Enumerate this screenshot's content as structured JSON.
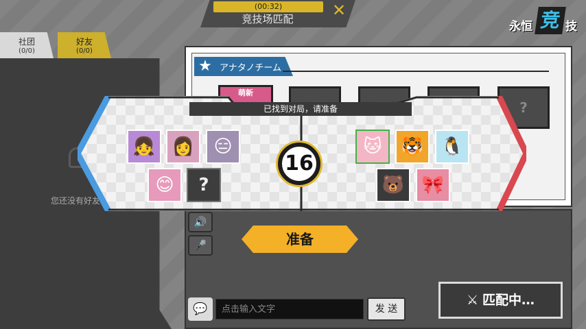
{
  "header": {
    "timer": "(00:32)",
    "title": "竞技场匹配",
    "cancel_icon": "close-icon",
    "accent_color": "#e0b930"
  },
  "logo": {
    "text_left": "永恒",
    "text_mid": "竞",
    "text_right": "技"
  },
  "sidebar": {
    "tabs": [
      {
        "label": "社团",
        "count": "(0/0)"
      },
      {
        "label": "好友",
        "count": "(0/0)"
      }
    ],
    "empty_text": "您还没有好友"
  },
  "team": {
    "title": "アナタノチーム",
    "slots": [
      {
        "label": "萌新"
      },
      {
        "label": "?"
      },
      {
        "label": "?"
      },
      {
        "label": "?"
      },
      {
        "label": "?"
      }
    ]
  },
  "match_found": {
    "message": "已找到对局，请准备",
    "countdown": "16",
    "left_team_color": "#4a9be0",
    "right_team_color": "#d9474f",
    "left_team": [
      "avatar",
      "avatar",
      "avatar",
      "avatar",
      "?"
    ],
    "right_team": [
      "avatar",
      "avatar",
      "avatar",
      "avatar",
      "avatar"
    ]
  },
  "ready_button": "准备",
  "chat": {
    "placeholder": "点击输入文字",
    "send_label": "发 送"
  },
  "matching_button": "匹配中…"
}
